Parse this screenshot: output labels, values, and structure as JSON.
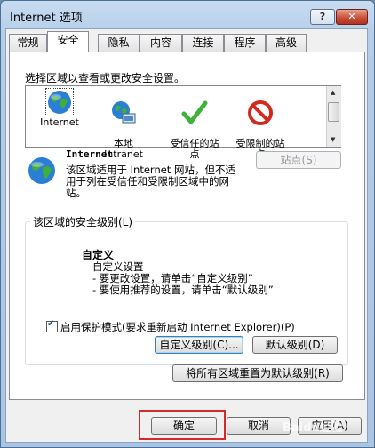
{
  "window": {
    "title": "Internet 选项",
    "help_label": "?",
    "close_label": "✕"
  },
  "tabs": [
    {
      "label": "常规"
    },
    {
      "label": "安全"
    },
    {
      "label": "隐私"
    },
    {
      "label": "内容"
    },
    {
      "label": "连接"
    },
    {
      "label": "程序"
    },
    {
      "label": "高级"
    }
  ],
  "active_tab": "安全",
  "zones": {
    "caption": "选择区域以查看或更改安全设置。",
    "items": [
      {
        "label": "Internet",
        "icon": "globe-icon"
      },
      {
        "label": "本地\nIntranet",
        "icon": "local-intranet-icon"
      },
      {
        "label": "受信任的站\n点",
        "icon": "check-icon"
      },
      {
        "label": "受限制的站\n点",
        "icon": "no-entry-icon"
      }
    ]
  },
  "selected_zone": {
    "name": "Internet",
    "description": "该区域适用于 Internet 网站，但不适用于列在受信任和受限制区域中的网站。",
    "sites_button": "站点(S)"
  },
  "security_level": {
    "group_label": "该区域的安全级别(L)",
    "level_name": "自定义",
    "level_desc": "自定义设置\n- 要更改设置，请单击“自定义级别”\n- 要使用推荐的设置，请单击“默认级别”",
    "protected_mode_label": "启用保护模式(要求重新启动 Internet Explorer)(P)",
    "protected_mode_checked": true,
    "custom_level_button": "自定义级别(C)...",
    "default_level_button": "默认级别(D)"
  },
  "reset_all_button": "将所有区域重置为默认级别(R)",
  "footer": {
    "ok": "确定",
    "cancel": "取消",
    "apply": "应用(A)"
  },
  "watermark": "Baidu经验",
  "colors": {
    "highlight": "#d42a2a",
    "titlebar": "#b4cde8"
  }
}
